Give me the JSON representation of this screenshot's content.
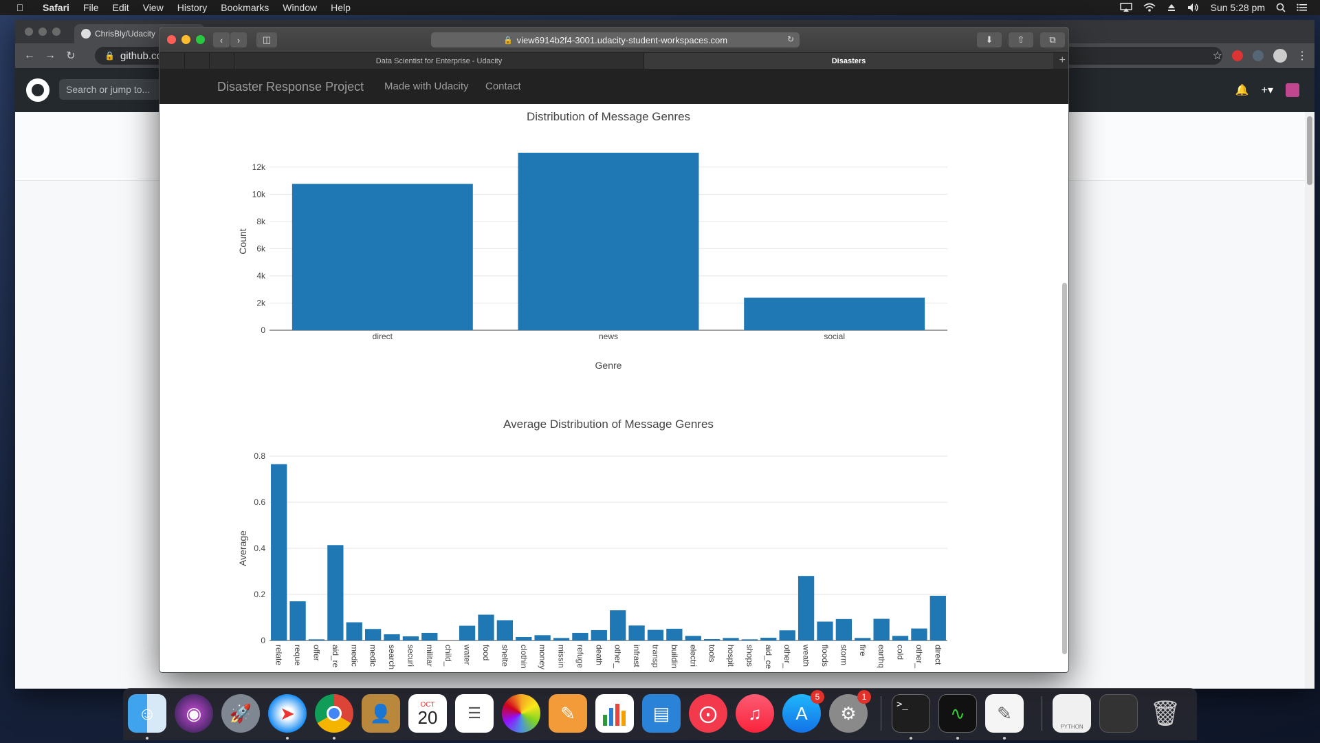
{
  "menubar": {
    "app_name": "Safari",
    "items": [
      "File",
      "Edit",
      "View",
      "History",
      "Bookmarks",
      "Window",
      "Help"
    ],
    "clock": "Sun 5:28 pm"
  },
  "chrome": {
    "tab_title": "ChrisBly/Udacity",
    "url": "github.com",
    "search_placeholder": "Search or jump to..."
  },
  "safari": {
    "url": "view6914b2f4-3001.udacity-student-workspaces.com",
    "tabs": [
      "Data Scientist for Enterprise - Udacity",
      "Disasters"
    ],
    "tab_plus": "+"
  },
  "navbar": {
    "brand": "Disaster Response Project",
    "links": [
      "Made with Udacity",
      "Contact"
    ]
  },
  "chart_data": [
    {
      "type": "bar",
      "title": "Distribution of Message Genres",
      "xlabel": "Genre",
      "ylabel": "Count",
      "categories": [
        "direct",
        "news",
        "social"
      ],
      "values": [
        10766,
        13054,
        2396
      ],
      "ylim": [
        0,
        13054
      ],
      "yticks": [
        0,
        2000,
        4000,
        6000,
        8000,
        10000,
        12000
      ],
      "ytick_labels": [
        "0",
        "2k",
        "4k",
        "6k",
        "8k",
        "10k",
        "12k"
      ],
      "color": "#1f77b4",
      "grid": true
    },
    {
      "type": "bar",
      "title": "Average Distribution of Message Genres",
      "xlabel": "",
      "ylabel": "Average",
      "categories": [
        "relate",
        "reque",
        "offer",
        "aid_re",
        "medic",
        "medic",
        "search",
        "securi",
        "militar",
        "child_",
        "water",
        "food",
        "shelte",
        "clothin",
        "money",
        "missin",
        "refuge",
        "death",
        "other_",
        "infrast",
        "transp",
        "buildin",
        "electri",
        "tools",
        "hospit",
        "shops",
        "aid_ce",
        "other_",
        "weath",
        "floods",
        "storm",
        "fire",
        "earthq",
        "cold",
        "other_",
        "direct"
      ],
      "values": [
        0.765,
        0.17,
        0.005,
        0.414,
        0.079,
        0.05,
        0.027,
        0.018,
        0.033,
        0.0,
        0.064,
        0.112,
        0.088,
        0.015,
        0.023,
        0.011,
        0.033,
        0.045,
        0.131,
        0.065,
        0.046,
        0.051,
        0.02,
        0.006,
        0.011,
        0.005,
        0.012,
        0.044,
        0.28,
        0.082,
        0.093,
        0.011,
        0.094,
        0.02,
        0.052,
        0.194
      ],
      "ylim": [
        0,
        0.8
      ],
      "yticks": [
        0,
        0.2,
        0.4,
        0.6,
        0.8
      ],
      "ytick_labels": [
        "0",
        "0.2",
        "0.4",
        "0.6",
        "0.8"
      ],
      "color": "#1f77b4",
      "grid": true
    }
  ],
  "dock": {
    "appstore_badge": "5",
    "prefs_badge": "1",
    "calendar_month": "OCT",
    "calendar_day": "20",
    "terminal_prompt": ">_",
    "python_label": "PYTHON"
  }
}
